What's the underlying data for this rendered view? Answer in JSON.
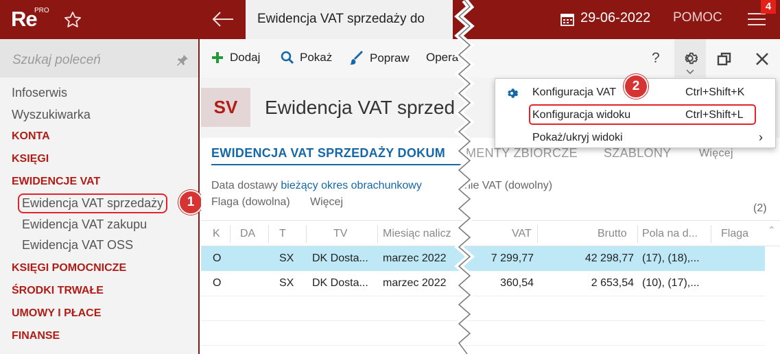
{
  "app": {
    "logo_text": "Re",
    "logo_sup": "PRO",
    "active_tab": "Ewidencja VAT sprzedaży do",
    "date": "29-06-2022",
    "help": "POMOC",
    "badge": "4"
  },
  "sidebar": {
    "search_placeholder": "Szukaj poleceń",
    "items": [
      {
        "label": "Infoserwis",
        "kind": "item"
      },
      {
        "label": "Wyszukiwarka",
        "kind": "item"
      },
      {
        "label": "KONTA",
        "kind": "section"
      },
      {
        "label": "KSIĘGI",
        "kind": "section"
      },
      {
        "label": "EWIDENCJE VAT",
        "kind": "section"
      },
      {
        "label": "Ewidencja VAT sprzedaży",
        "kind": "sub"
      },
      {
        "label": "Ewidencja VAT zakupu",
        "kind": "sub"
      },
      {
        "label": "Ewidencja VAT OSS",
        "kind": "sub"
      },
      {
        "label": "KSIĘGI POMOCNICZE",
        "kind": "section"
      },
      {
        "label": "ŚRODKI TRWAŁE",
        "kind": "section"
      },
      {
        "label": "UMOWY I PŁACE",
        "kind": "section"
      },
      {
        "label": "FINANSE",
        "kind": "section"
      }
    ],
    "step_badge": "1"
  },
  "toolbar": {
    "add": "Dodaj",
    "show": "Pokaż",
    "edit": "Popraw",
    "ops": "Opera",
    "help": "?"
  },
  "document": {
    "code": "SV",
    "title": "Ewidencja VAT sprzed",
    "tabs_main": "EWIDENCJA VAT SPRZEDAŻY DOKUM",
    "tabs_rest": "MENTY ZBIORCZE",
    "tab_templates": "SZABLONY",
    "tab_more": "Więcej",
    "filter1_label": "Data dostawy",
    "filter1_value": "bieżący okres obrachunkowy",
    "filter2_label": "nie VAT (dowolny)",
    "filter3_label": "Flaga (dowolna)",
    "filter_more": "Więcej",
    "count": "(2)"
  },
  "table": {
    "columns": [
      "K",
      "DA",
      "T",
      "TV",
      "Miesiąc nalicz",
      "VAT",
      "Brutto",
      "Pola na d...",
      "Flaga"
    ],
    "rows": [
      {
        "K": "O",
        "DA": "",
        "T": "SX",
        "TV": "DK Dosta...",
        "month": "marzec 2022",
        "VAT": "7 299,77",
        "Brutto": "42 298,77",
        "pola": "(17), (18),...",
        "flaga": ""
      },
      {
        "K": "O",
        "DA": "",
        "T": "SX",
        "TV": "DK Dosta...",
        "month": "marzec 2022",
        "VAT": "360,54",
        "Brutto": "2 653,54",
        "pola": "(10), (17),...",
        "flaga": ""
      }
    ]
  },
  "dropdown": {
    "items": [
      {
        "label": "Konfiguracja VAT",
        "shortcut": "Ctrl+Shift+K"
      },
      {
        "label": "Konfiguracja widoku",
        "shortcut": "Ctrl+Shift+L"
      },
      {
        "label": "Pokaż/ukryj widoki",
        "shortcut": "›"
      }
    ],
    "step_badge": "2"
  },
  "colors": {
    "brand": "#8c1712",
    "accent_blue": "#1468a8",
    "selected_row": "#bfe8f7",
    "highlight_red": "#e3232a"
  }
}
